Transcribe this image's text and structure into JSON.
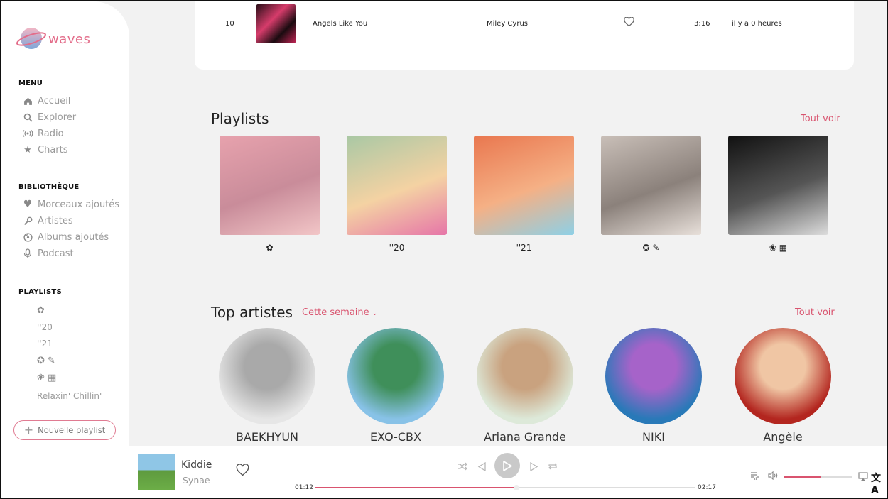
{
  "app": {
    "logo_text": "waves"
  },
  "sidebar": {
    "menu_title": "MENU",
    "menu_items": [
      {
        "label": "Accueil",
        "icon": "home-icon"
      },
      {
        "label": "Explorer",
        "icon": "search-icon"
      },
      {
        "label": "Radio",
        "icon": "radio-icon"
      },
      {
        "label": "Charts",
        "icon": "star-icon"
      }
    ],
    "library_title": "BIBLIOTHÈQUE",
    "library_items": [
      {
        "label": "Morceaux ajoutés",
        "icon": "heart-icon"
      },
      {
        "label": "Artistes",
        "icon": "microphone-icon"
      },
      {
        "label": "Albums ajoutés",
        "icon": "album-icon"
      },
      {
        "label": "Podcast",
        "icon": "podcast-mic-icon"
      }
    ],
    "playlists_title": "PLAYLISTS",
    "playlists": [
      {
        "label": "",
        "icon": "emoji-icon"
      },
      {
        "label": "''20"
      },
      {
        "label": "''21"
      },
      {
        "label": "",
        "icon": "emoji-pair-icon"
      },
      {
        "label": "",
        "icon": "emoji-pair-icon"
      },
      {
        "label": "Relaxin' Chillin'"
      }
    ],
    "new_playlist_label": "Nouvelle playlist"
  },
  "track_row": {
    "number": "10",
    "title": "Angels Like You",
    "artist": "Miley Cyrus",
    "duration": "3:16",
    "added": "il y a 0 heures"
  },
  "playlists_section": {
    "title": "Playlists",
    "see_all": "Tout voir",
    "cards": [
      {
        "label": "",
        "colors": [
          "#e7a2ad",
          "#c98c9a",
          "#f2c6c7"
        ]
      },
      {
        "label": "''20",
        "colors": [
          "#a9c8a4",
          "#f4d2a3",
          "#e676a8"
        ]
      },
      {
        "label": "''21",
        "colors": [
          "#e9774f",
          "#f5b085",
          "#8ed0e6"
        ]
      },
      {
        "label": "",
        "colors": [
          "#c9bfb8",
          "#8b817b",
          "#e8e0da"
        ]
      },
      {
        "label": "",
        "colors": [
          "#111111",
          "#555555",
          "#dddddd"
        ]
      }
    ]
  },
  "artists_section": {
    "title": "Top artistes",
    "filter": "Cette semaine",
    "see_all": "Tout voir",
    "artists": [
      {
        "name": "BAEKHYUN",
        "colors": [
          "#e6e6e6",
          "#a9a9a9"
        ]
      },
      {
        "name": "EXO-CBX",
        "colors": [
          "#88c2e7",
          "#3f8f5a"
        ]
      },
      {
        "name": "Ariana Grande",
        "colors": [
          "#dde9d9",
          "#c9a27f"
        ]
      },
      {
        "name": "NIKI",
        "colors": [
          "#2979b8",
          "#a663c9"
        ]
      },
      {
        "name": "Angèle",
        "colors": [
          "#b3261f",
          "#f0c6a4"
        ]
      }
    ]
  },
  "player": {
    "title": "Kiddie",
    "artist": "Synae",
    "elapsed": "01:12",
    "total": "02:17",
    "progress_fraction": 0.53,
    "volume_fraction": 0.55
  },
  "accent": "#d9546f"
}
